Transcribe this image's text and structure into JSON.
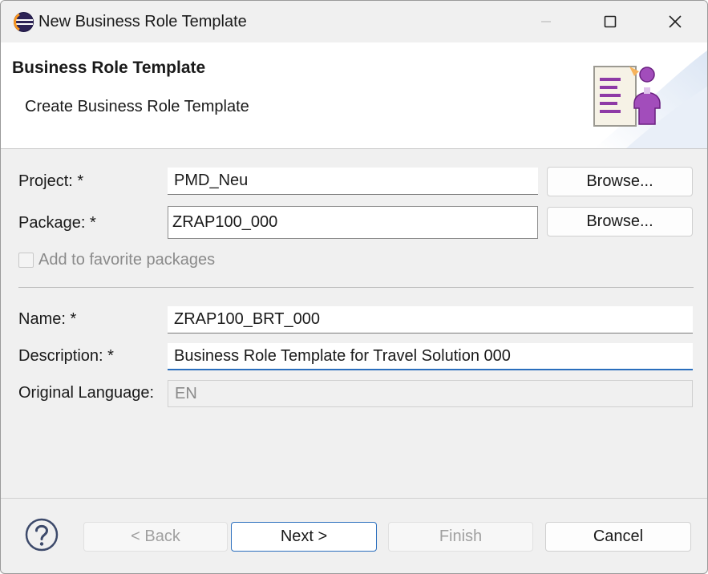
{
  "window": {
    "title": "New Business Role Template",
    "icon": "eclipse-icon",
    "controls": [
      "minimize-icon",
      "maximize-icon",
      "close-icon"
    ]
  },
  "banner": {
    "title": "Business Role Template",
    "subtitle": "Create Business Role Template",
    "icon": "business-role-template-icon"
  },
  "form": {
    "project": {
      "label": "Project: *",
      "value": "PMD_Neu",
      "browse": "Browse..."
    },
    "package": {
      "label": "Package: *",
      "value": "ZRAP100_000",
      "browse": "Browse..."
    },
    "favorite": {
      "label": "Add to favorite packages",
      "checked": false,
      "enabled": false
    },
    "name": {
      "label": "Name: *",
      "value": "ZRAP100_BRT_000"
    },
    "description": {
      "label": "Description: *",
      "value": "Business Role Template for Travel Solution 000"
    },
    "language": {
      "label": "Original Language:",
      "value": "EN",
      "enabled": false
    }
  },
  "footer": {
    "help_icon": "help-icon",
    "back": "< Back",
    "next": "Next >",
    "finish": "Finish",
    "cancel": "Cancel"
  },
  "colors": {
    "accent": "#2a6ebd",
    "dialog_bg": "#f0f0f0",
    "icon_purple": "#8e3aa6"
  }
}
